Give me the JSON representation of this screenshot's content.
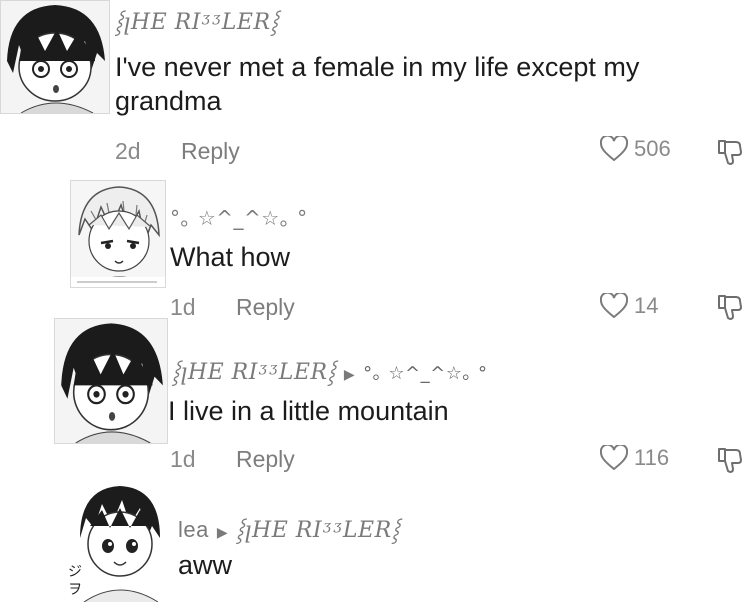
{
  "comments": [
    {
      "username": "⸾ꞁHE RIᶾᶾLER⸾",
      "text": "I've never met a female in my life except my grandma",
      "time": "2d",
      "reply_label": "Reply",
      "likes": "506",
      "avatar_icon": "anime-boy-avatar-icon"
    },
    {
      "username": "°｡ ☆^_^☆｡ °",
      "text": "What how",
      "time": "1d",
      "reply_label": "Reply",
      "likes": "14",
      "avatar_icon": "anime-blonde-avatar-icon"
    },
    {
      "username": "⸾ꞁHE RIᶾᶾLER⸾",
      "reply_to": "°｡ ☆^_^☆｡ °",
      "text": "I live in a little mountain",
      "time": "1d",
      "reply_label": "Reply",
      "likes": "116",
      "avatar_icon": "anime-boy-avatar-icon"
    },
    {
      "username": "lea",
      "reply_to": "⸾ꞁHE RIᶾᶾLER⸾",
      "text": "aww",
      "avatar_icon": "anime-smiling-avatar-icon"
    }
  ],
  "icons": {
    "like": "heart-outline-icon",
    "dislike": "thumbs-down-outline-icon",
    "reply_arrow": "play-arrow-icon"
  }
}
